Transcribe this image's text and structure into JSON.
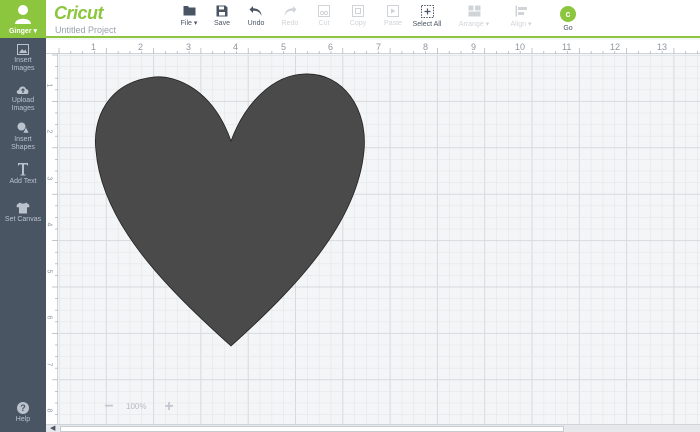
{
  "user": {
    "name": "Ginger"
  },
  "sidebar": {
    "items": [
      {
        "label": "Insert\nImages",
        "icon": "image-icon"
      },
      {
        "label": "Upload\nImages",
        "icon": "cloud-upload-icon"
      },
      {
        "label": "Insert\nShapes",
        "icon": "shapes-icon"
      },
      {
        "label": "Add Text",
        "icon": "text-icon"
      },
      {
        "label": "Set Canvas",
        "icon": "shirt-icon"
      }
    ],
    "help_label": "Help"
  },
  "toolbar": {
    "logo": "Cricut",
    "project_name": "Untitled Project",
    "file_label": "File",
    "save_label": "Save",
    "undo_label": "Undo",
    "redo_label": "Redo",
    "cut_label": "Cut",
    "copy_label": "Copy",
    "paste_label": "Paste",
    "select_all_label": "Select All",
    "arrange_label": "Arrange",
    "align_label": "Align",
    "go_label": "Go"
  },
  "ruler": {
    "top": [
      "1",
      "2",
      "3",
      "4",
      "5",
      "6",
      "7",
      "8",
      "9",
      "10",
      "11",
      "12",
      "13"
    ],
    "left": [
      "1",
      "2",
      "3",
      "4",
      "5",
      "6",
      "7",
      "8"
    ]
  },
  "zoom": {
    "minus": "−",
    "percent": "100%",
    "plus": "+"
  },
  "canvas": {
    "shape_color": "#4a4a4a",
    "grid_color": "#e3e6ea",
    "grid_major_color": "#d6dade"
  },
  "colors": {
    "accent": "#8cc63f",
    "sidebar": "#4a5564"
  }
}
